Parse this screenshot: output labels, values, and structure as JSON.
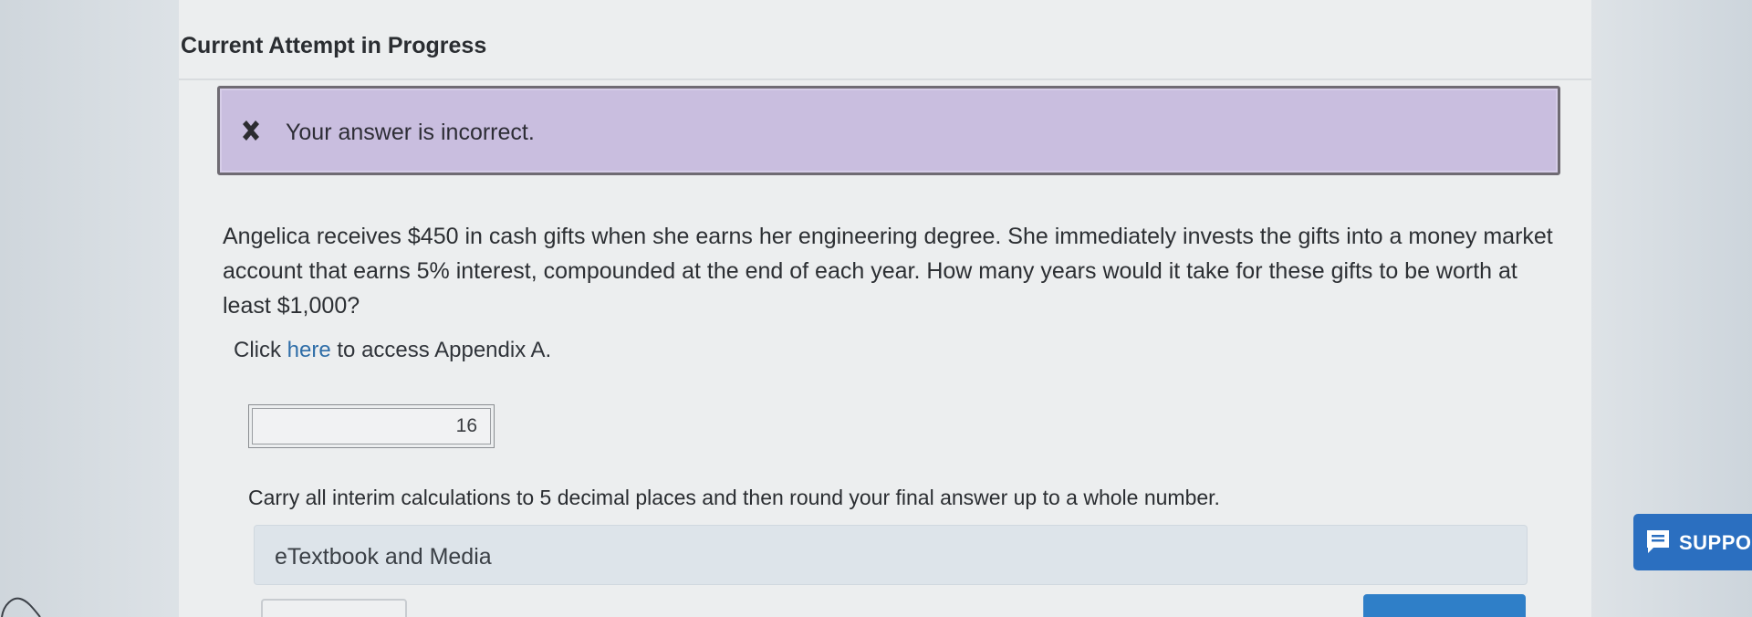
{
  "attempt": {
    "title": "Current Attempt in Progress"
  },
  "feedback": {
    "icon": "close-x-icon",
    "message": "Your answer is incorrect."
  },
  "question": {
    "text": "Angelica receives $450 in cash gifts when she earns her engineering degree. She immediately invests the gifts into a money market account that earns 5% interest, compounded at the end of each year. How many years would it take for these gifts to be worth at least $1,000?"
  },
  "appendix": {
    "prefix": "Click ",
    "link": "here",
    "suffix": " to access Appendix A."
  },
  "answer": {
    "value": "16"
  },
  "instruction": "Carry all interim calculations to 5 decimal places and then round your final answer up to a whole number.",
  "media": {
    "label": "eTextbook and Media"
  },
  "support": {
    "label": "SUPPO",
    "icon": "chat-icon"
  },
  "colors": {
    "feedback_bg": "#c9bedf",
    "link": "#2f6ea8",
    "support_bg": "#2b6fc0"
  }
}
